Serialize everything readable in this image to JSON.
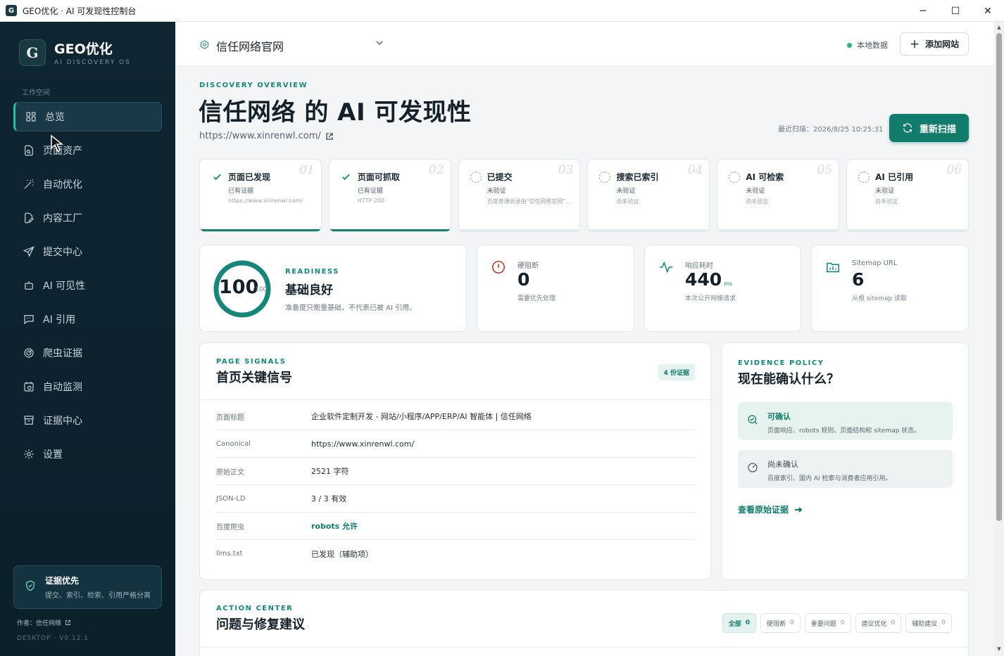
{
  "window": {
    "title": "GEO优化 · AI 可发现性控制台",
    "controls": [
      "─",
      "☐",
      "✕"
    ]
  },
  "sidebar": {
    "brand_name": "GEO优化",
    "brand_logo": "G",
    "brand_sub": "AI DISCOVERY OS",
    "section_label": "工作空间",
    "items": [
      {
        "label": "总览",
        "icon": "grid-icon",
        "active": true
      },
      {
        "label": "页面资产",
        "icon": "file-search-icon"
      },
      {
        "label": "自动优化",
        "icon": "magic-wand-icon"
      },
      {
        "label": "内容工厂",
        "icon": "edit-document-icon"
      },
      {
        "label": "提交中心",
        "icon": "send-icon"
      },
      {
        "label": "AI 可见性",
        "icon": "bot-icon"
      },
      {
        "label": "AI 引用",
        "icon": "quote-message-icon"
      },
      {
        "label": "爬虫证据",
        "icon": "radar-icon"
      },
      {
        "label": "自动监测",
        "icon": "calendar-clock-icon"
      },
      {
        "label": "证据中心",
        "icon": "archive-icon"
      },
      {
        "label": "设置",
        "icon": "gear-icon"
      }
    ],
    "proof_title": "证据优先",
    "proof_desc": "提交、索引、检索、引用严格分离",
    "author": "作者：信任网络",
    "version": "DESKTOP · V0.12.1"
  },
  "topbar": {
    "site_name": "信任网络官网",
    "local_data": "本地数据",
    "add_site": "添加网站"
  },
  "hero": {
    "overline": "DISCOVERY OVERVIEW",
    "title": "信任网络 的 AI 可发现性",
    "url": "https://www.xinrenwl.com/",
    "last_scan": "最近扫描：2026/8/25 10:25:31",
    "rescan": "重新扫描"
  },
  "stages": [
    {
      "num": "01",
      "title": "页面已发现",
      "status": "已有证据",
      "detail": "https://www.xinrenwl.com/",
      "done": true
    },
    {
      "num": "02",
      "title": "页面可抓取",
      "status": "已有证据",
      "detail": "HTTP 200",
      "done": true
    },
    {
      "num": "03",
      "title": "已提交",
      "status": "未验证",
      "detail": "百度普通收录由\"信任网络官网\"...",
      "done": false
    },
    {
      "num": "04",
      "title": "搜索已索引",
      "status": "未验证",
      "detail": "尚未验证",
      "done": false
    },
    {
      "num": "05",
      "title": "AI 可检索",
      "status": "未验证",
      "detail": "尚未验证",
      "done": false
    },
    {
      "num": "06",
      "title": "AI 已引用",
      "status": "未验证",
      "detail": "尚未验证",
      "done": false
    }
  ],
  "readiness": {
    "score": "100",
    "score_max": "/100",
    "score_fraction": 1.0,
    "overline": "READINESS",
    "title": "基础良好",
    "desc": "准备度只衡量基础，不代表已被 AI 引用。"
  },
  "metrics": {
    "blocking": {
      "label": "硬阻断",
      "value": "0",
      "desc": "需要优先处理"
    },
    "response": {
      "label": "响应耗时",
      "value": "440",
      "unit": "ms",
      "desc": "本次公开网络请求"
    },
    "sitemap": {
      "label": "Sitemap URL",
      "value": "6",
      "desc": "从根 sitemap 读取"
    }
  },
  "signals": {
    "overline": "PAGE SIGNALS",
    "title": "首页关键信号",
    "badge": "4 份证据",
    "rows": [
      {
        "key": "页面标题",
        "value": "企业软件定制开发 - 网站/小程序/APP/ERP/AI 智能体 | 信任网络"
      },
      {
        "key": "Canonical",
        "value": "https://www.xinrenwl.com/"
      },
      {
        "key": "原始正文",
        "value": "2521 字符"
      },
      {
        "key": "JSON-LD",
        "value": "3 / 3 有效"
      },
      {
        "key": "百度爬虫",
        "value": "robots 允许",
        "accent": true
      },
      {
        "key": "llms.txt",
        "value": "已发现（辅助项）"
      }
    ]
  },
  "evidence": {
    "overline": "EVIDENCE POLICY",
    "title": "现在能确认什么？",
    "confirmed_title": "可确认",
    "confirmed_desc": "页面响应、robots 规则、页面结构和 sitemap 状态。",
    "unconfirmed_title": "尚未确认",
    "unconfirmed_desc": "百度索引、国内 AI 检索与消费者应用引用。",
    "link": "查看原始证据"
  },
  "action": {
    "overline": "ACTION CENTER",
    "title": "问题与修复建议",
    "filters": [
      {
        "label": "全部",
        "count": "0",
        "active": true
      },
      {
        "label": "硬阻断",
        "count": "0"
      },
      {
        "label": "重要问题",
        "count": "0"
      },
      {
        "label": "建议优化",
        "count": "0"
      },
      {
        "label": "辅助建议",
        "count": "0"
      }
    ]
  }
}
